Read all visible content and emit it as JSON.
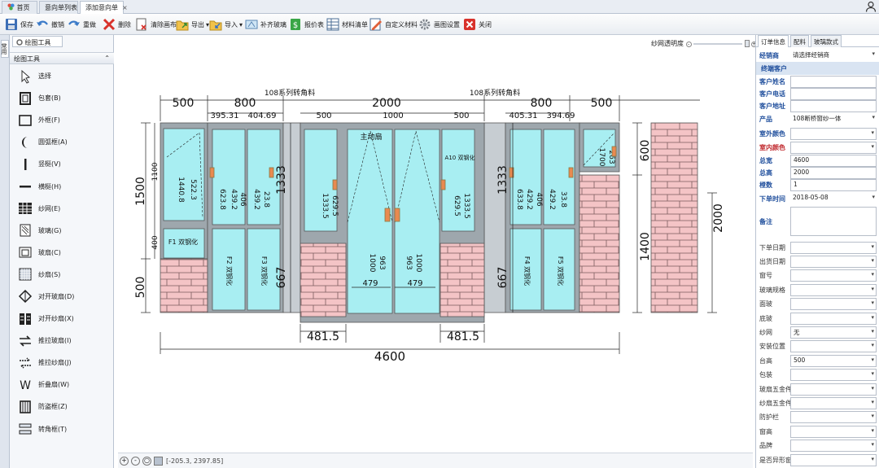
{
  "tabs": [
    {
      "label": "首页"
    },
    {
      "label": "意向单列表"
    },
    {
      "label": "添加意向单",
      "close": "×"
    }
  ],
  "toolbar": [
    {
      "label": "保存",
      "icon": "save-icon"
    },
    {
      "label": "撤销",
      "icon": "undo-icon"
    },
    {
      "label": "重做",
      "icon": "redo-icon"
    },
    {
      "label": "删除",
      "icon": "delete-icon"
    },
    {
      "label": "清除画布",
      "icon": "clear-canvas-icon"
    },
    {
      "label": "导出",
      "icon": "export-icon"
    },
    {
      "label": "导入",
      "icon": "import-icon"
    },
    {
      "label": "补齐玻璃",
      "icon": "fill-glass-icon"
    },
    {
      "label": "报价表",
      "icon": "quote-icon"
    },
    {
      "label": "材料清单",
      "icon": "material-list-icon"
    },
    {
      "label": "自定义材料",
      "icon": "custom-material-icon"
    },
    {
      "label": "画图设置",
      "icon": "settings-icon"
    },
    {
      "label": "关闭",
      "icon": "close-icon"
    }
  ],
  "left_strip": {
    "label": "常用"
  },
  "panel": {
    "tab": "绘图工具",
    "header": "绘图工具",
    "tools": [
      {
        "label": "选择",
        "icon": "cursor-icon"
      },
      {
        "label": "包套(B)",
        "icon": "wrap-icon"
      },
      {
        "label": "外框(F)",
        "icon": "outer-frame-icon"
      },
      {
        "label": "圆弧框(A)",
        "icon": "arc-frame-icon"
      },
      {
        "label": "竖梃(V)",
        "icon": "vertical-mullion-icon"
      },
      {
        "label": "横梃(H)",
        "icon": "horizontal-mullion-icon"
      },
      {
        "label": "纱网(E)",
        "icon": "screen-mesh-icon"
      },
      {
        "label": "玻璃(G)",
        "icon": "glass-icon"
      },
      {
        "label": "玻扇(C)",
        "icon": "glass-sash-icon"
      },
      {
        "label": "纱扇(S)",
        "icon": "screen-sash-icon"
      },
      {
        "label": "对开玻扇(D)",
        "icon": "double-glass-sash-icon"
      },
      {
        "label": "对开纱扇(X)",
        "icon": "double-screen-sash-icon"
      },
      {
        "label": "推拉玻扇(I)",
        "icon": "sliding-glass-sash-icon"
      },
      {
        "label": "推拉纱扇(J)",
        "icon": "sliding-screen-sash-icon"
      },
      {
        "label": "折叠扇(W)",
        "icon": "folding-sash-icon"
      },
      {
        "label": "防盗框(Z)",
        "icon": "security-frame-icon"
      },
      {
        "label": "转角框(T)",
        "icon": "corner-frame-icon"
      }
    ]
  },
  "canvas": {
    "slider_label": "纱网透明度",
    "dims": {
      "top_segments": [
        "500",
        "800",
        "2000",
        "800",
        "500"
      ],
      "sub_segments": [
        "395.31",
        "404.69",
        "500",
        "1000",
        "500",
        "405.31",
        "394.69"
      ],
      "corner_labels": [
        "108系列转角料",
        "108系列转角料"
      ],
      "total_width": "4600",
      "bottom_dims": [
        "481.5",
        "481.5"
      ],
      "left_heights": [
        "1500",
        "500",
        "1100",
        "400"
      ],
      "inner_heights": [
        "1333",
        "667",
        "1333",
        "667"
      ],
      "right_heights": [
        "600",
        "1400",
        "2000"
      ],
      "door_label": "主动扇",
      "fixed_label": "F1 双钢化",
      "small_dims": [
        "1440.8",
        "522.3",
        "623.8",
        "439.2",
        "406",
        "439.2",
        "23.8",
        "1333.5",
        "629.5",
        "1000",
        "963",
        "479",
        "479",
        "963",
        "1000",
        "629.5",
        "1333.5",
        "633.8",
        "429.2",
        "406",
        "429.2",
        "33.8",
        "1700",
        "263"
      ],
      "vertical_labels": [
        "F2 双钢化",
        "F3 双钢化",
        "F4 双钢化",
        "F5 双钢化",
        "A10 双钢化"
      ]
    }
  },
  "status": {
    "coords": "[-205.3, 2397.85]"
  },
  "right": {
    "tabs": [
      "订单信息",
      "配料",
      "玻璃款式"
    ],
    "dealer": {
      "label": "经销商",
      "value": "请选择经销商"
    },
    "end_customer": "终端客户",
    "customer_name": {
      "label": "客户姓名",
      "value": ""
    },
    "customer_phone": {
      "label": "客户电话",
      "value": ""
    },
    "customer_address": {
      "label": "客户地址",
      "value": ""
    },
    "product": {
      "label": "产品",
      "value": "108断桥窗纱一体"
    },
    "outer_color": {
      "label": "室外颜色",
      "value": ""
    },
    "inner_color": {
      "label": "室内颜色",
      "value": ""
    },
    "total_width": {
      "label": "总宽",
      "value": "4600"
    },
    "total_height": {
      "label": "总高",
      "value": "2000"
    },
    "count": {
      "label": "樘数",
      "value": "1"
    },
    "order_time": {
      "label": "下单时间",
      "value": "2018-05-08"
    },
    "notes": {
      "label": "备注"
    },
    "fields": [
      {
        "label": "下单日期",
        "value": ""
      },
      {
        "label": "出货日期",
        "value": ""
      },
      {
        "label": "窗号",
        "value": ""
      },
      {
        "label": "玻璃规格",
        "value": ""
      },
      {
        "label": "面玻",
        "value": ""
      },
      {
        "label": "底玻",
        "value": ""
      },
      {
        "label": "纱网",
        "value": "无"
      },
      {
        "label": "安装位置",
        "value": ""
      },
      {
        "label": "台高",
        "value": "500"
      },
      {
        "label": "包装",
        "value": ""
      },
      {
        "label": "玻扇五金件",
        "value": ""
      },
      {
        "label": "纱扇五金件",
        "value": ""
      },
      {
        "label": "防护栏",
        "value": ""
      },
      {
        "label": "窗高",
        "value": ""
      },
      {
        "label": "品牌",
        "value": ""
      },
      {
        "label": "是否异形窗",
        "value": ""
      }
    ]
  },
  "colors": {
    "glass": "#a8eef2",
    "brick": "#f4c4c6",
    "frame": "#9ea7ad",
    "handle": "#e98a50",
    "header_blue": "#1f4e9c",
    "label_red": "#c0282d"
  }
}
